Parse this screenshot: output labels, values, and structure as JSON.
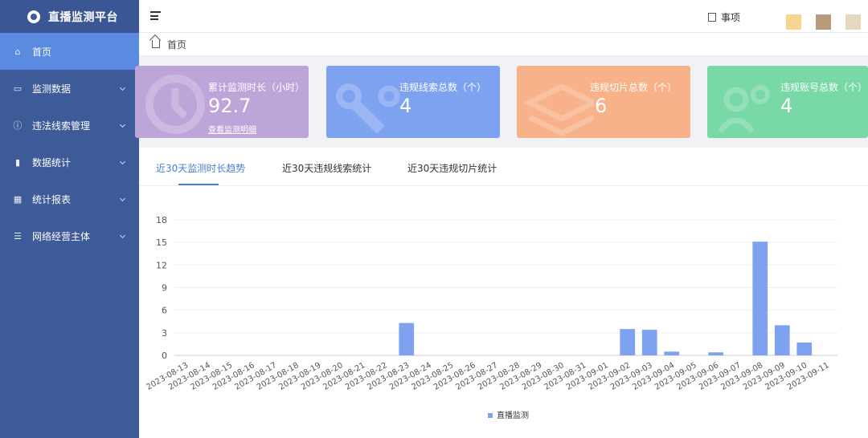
{
  "sidebar": {
    "brand": "直播监测平台",
    "items": [
      {
        "label": "首页",
        "icon": "home-icon",
        "active": true,
        "expandable": false
      },
      {
        "label": "监测数据",
        "icon": "monitor-icon",
        "expandable": true
      },
      {
        "label": "违法线索管理",
        "icon": "alert-circle-icon",
        "expandable": true
      },
      {
        "label": "数据统计",
        "icon": "bar-chart-icon",
        "expandable": true
      },
      {
        "label": "统计报表",
        "icon": "table-icon",
        "expandable": true
      },
      {
        "label": "网络经营主体",
        "icon": "database-icon",
        "expandable": true
      }
    ]
  },
  "header": {
    "menu_icon": "menu-fold-icon",
    "todo_label": "事项",
    "theme_colors": [
      "#f7d58f",
      "#b89a7d",
      "#e6d7be"
    ]
  },
  "breadcrumb": {
    "home_label": "首页"
  },
  "cards": [
    {
      "label": "累计监测时长（小时）",
      "value": "92.7",
      "link": "查看监测明细",
      "color": "#bda5d9"
    },
    {
      "label": "违规线索总数（个）",
      "value": "4",
      "color": "#7ea2f0"
    },
    {
      "label": "违规切片总数（个）",
      "value": "6",
      "color": "#f8b289"
    },
    {
      "label": "违规账号总数（个）",
      "value": "4",
      "color": "#78d8a6"
    }
  ],
  "tabs": [
    "近30天监测时长趋势",
    "近30天违规线索统计",
    "近30天违规切片统计"
  ],
  "chart_data": {
    "type": "bar",
    "categories": [
      "2023-08-13",
      "2023-08-14",
      "2023-08-15",
      "2023-08-16",
      "2023-08-17",
      "2023-08-18",
      "2023-08-19",
      "2023-08-20",
      "2023-08-21",
      "2023-08-22",
      "2023-08-23",
      "2023-08-24",
      "2023-08-25",
      "2023-08-26",
      "2023-08-27",
      "2023-08-28",
      "2023-08-29",
      "2023-08-30",
      "2023-08-31",
      "2023-09-01",
      "2023-09-02",
      "2023-09-03",
      "2023-09-04",
      "2023-09-05",
      "2023-09-06",
      "2023-09-07",
      "2023-09-08",
      "2023-09-09",
      "2023-09-10",
      "2023-09-11"
    ],
    "series": [
      {
        "name": "直播监测",
        "color": "#7ea2f0",
        "values": [
          0,
          0,
          0,
          0,
          0,
          0,
          0,
          0,
          0,
          0,
          4.3,
          0,
          0,
          0,
          0,
          0,
          0,
          0,
          0,
          0,
          3.5,
          3.4,
          0.5,
          0,
          0.4,
          0,
          15.1,
          4.0,
          1.7,
          0
        ]
      }
    ],
    "yticks": [
      0,
      3,
      6,
      9,
      12,
      15,
      18
    ],
    "ylim": [
      0,
      18
    ],
    "grid": true,
    "legend": "bottom"
  }
}
